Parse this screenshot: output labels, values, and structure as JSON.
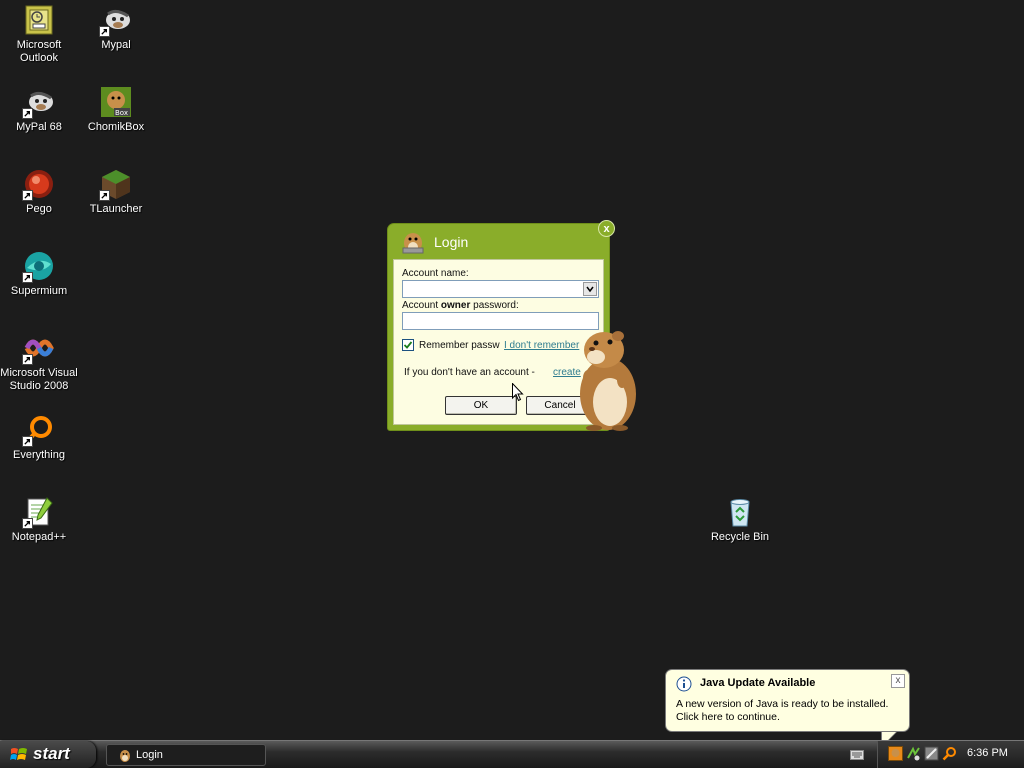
{
  "desktop": {
    "icons": [
      {
        "label": "Microsoft\nOutlook",
        "icon": "outlook-icon"
      },
      {
        "label": "Mypal",
        "icon": "mypal-icon"
      },
      {
        "label": "MyPal 68",
        "icon": "mypal68-icon"
      },
      {
        "label": "ChomikBox",
        "icon": "chomikbox-icon"
      },
      {
        "label": "Pego",
        "icon": "pego-icon"
      },
      {
        "label": "TLauncher",
        "icon": "tlauncher-icon"
      },
      {
        "label": "Supermium",
        "icon": "supermium-icon"
      },
      {
        "label": "Microsoft Visual\nStudio 2008",
        "icon": "visual-studio-icon"
      },
      {
        "label": "Everything",
        "icon": "everything-icon"
      },
      {
        "label": "Notepad++",
        "icon": "notepadpp-icon"
      },
      {
        "label": "Recycle Bin",
        "icon": "recycle-bin-icon"
      }
    ]
  },
  "login": {
    "title": "Login",
    "account_name_label": "Account name:",
    "account_name_value": "",
    "password_label_pre": "Account ",
    "password_label_bold": "owner",
    "password_label_post": " password:",
    "password_value": "",
    "remember_label": "Remember passw",
    "remember_checked": true,
    "forgot_link": "I don't remember",
    "no_account_text": "If you don't have an account - ",
    "create_link": "create",
    "ok_label": "OK",
    "cancel_label": "Cancel",
    "close_label": "x",
    "accent": "#8aad2a"
  },
  "balloon": {
    "title": "Java Update Available",
    "message": "A new version of Java is ready to be installed.\nClick here to continue.",
    "close_label": "x"
  },
  "taskbar": {
    "start_label": "start",
    "tasks": [
      {
        "label": "Login"
      }
    ],
    "clock": "6:36 PM"
  }
}
